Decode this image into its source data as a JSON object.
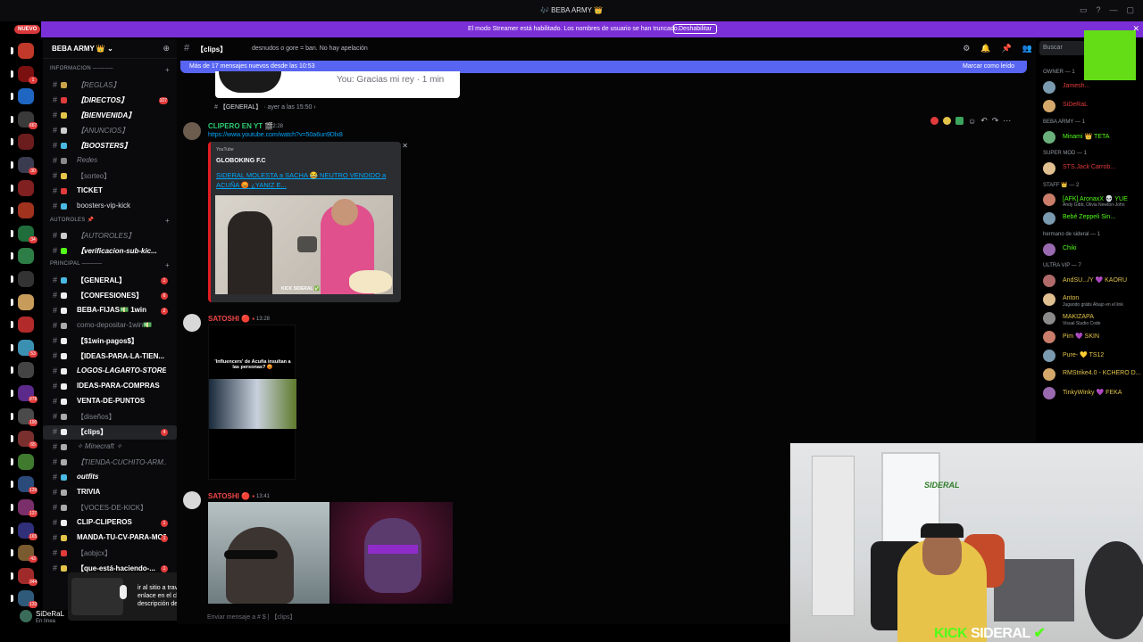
{
  "window": {
    "title": "🎶 BEBA ARMY 👑"
  },
  "nuevo_badge": "NUEVO",
  "servers": [
    {
      "color": "#c0392b",
      "badge": ""
    },
    {
      "color": "#7a1010",
      "badge": "1"
    },
    {
      "color": "#1e66c2",
      "badge": ""
    },
    {
      "color": "#3a3a3a",
      "badge": "667"
    },
    {
      "color": "#6b1d1d",
      "badge": ""
    },
    {
      "color": "#3b3b4f",
      "badge": "30"
    },
    {
      "color": "#802020",
      "badge": ""
    },
    {
      "color": "#a0321e",
      "badge": ""
    },
    {
      "color": "#1f6d3b",
      "badge": "34"
    },
    {
      "color": "#2d7d46",
      "badge": ""
    },
    {
      "color": "#333333",
      "badge": ""
    },
    {
      "color": "#c79c5a",
      "badge": ""
    },
    {
      "color": "#b22a2a",
      "badge": ""
    },
    {
      "color": "#3b8fb0",
      "badge": "53"
    },
    {
      "color": "#444444",
      "badge": ""
    },
    {
      "color": "#5c2a8a",
      "badge": "878"
    },
    {
      "color": "#4a4a4a",
      "badge": "190"
    },
    {
      "color": "#7a2f2f",
      "badge": "65"
    },
    {
      "color": "#3f7a2f",
      "badge": ""
    },
    {
      "color": "#2a4a7a",
      "badge": "139"
    },
    {
      "color": "#7a2f6a",
      "badge": "137"
    },
    {
      "color": "#2f2f7a",
      "badge": "165"
    },
    {
      "color": "#7a5a2f",
      "badge": "43"
    },
    {
      "color": "#a02a2a",
      "badge": "344"
    },
    {
      "color": "#2f5a7a",
      "badge": "133"
    }
  ],
  "streamer_bar": {
    "text": "El modo Streamer está habilitado. Los nombres de usuario se han truncado.",
    "button": "Deshabilitar",
    "close": "✕"
  },
  "server": {
    "name": "BEBA ARMY 👑 ⌄"
  },
  "categories": [
    {
      "label": "INFORMACION ─────"
    },
    {
      "label": "AUTOROLES 📌"
    },
    {
      "label": "PRINCIPAL ─────"
    }
  ],
  "channels": [
    {
      "name": "【REGLAS】",
      "emoji": "#c8a34a",
      "style": "m i",
      "badge": ""
    },
    {
      "name": "【DIRECTOS】",
      "emoji": "#e23b3b",
      "style": "b i",
      "badge": "107"
    },
    {
      "name": "【BIENVENIDA】",
      "emoji": "#e2c44a",
      "style": "b i",
      "badge": ""
    },
    {
      "name": "【ANUNCIOS】",
      "emoji": "#cccccc",
      "style": "m i",
      "badge": ""
    },
    {
      "name": "【BOOSTERS】",
      "emoji": "#4ab8e2",
      "style": "b i",
      "badge": ""
    },
    {
      "name": "Redes",
      "emoji": "#888888",
      "style": "m i",
      "badge": ""
    },
    {
      "name": "【sorteo】",
      "emoji": "#e2c44a",
      "style": "m",
      "badge": ""
    },
    {
      "name": "TICKET",
      "emoji": "#e23b3b",
      "style": "b",
      "badge": ""
    },
    {
      "name": "boosters-vip-kick",
      "emoji": "#4ab8e2",
      "style": "",
      "badge": ""
    },
    {
      "name": "【AUTOROLES】",
      "emoji": "#cccccc",
      "style": "m i",
      "badge": ""
    },
    {
      "name": "【verificacion-sub-kic...",
      "emoji": "#53fc18",
      "style": "b i",
      "badge": ""
    },
    {
      "name": "【GENERAL】",
      "emoji": "#4ab8e2",
      "style": "b",
      "badge": "1"
    },
    {
      "name": "【CONFESIONES】",
      "emoji": "#eeeeee",
      "style": "b",
      "badge": "6"
    },
    {
      "name": "BEBA-FIJAS💵 1win",
      "emoji": "#eeeeee",
      "style": "b",
      "badge": "2"
    },
    {
      "name": "como-depositar-1win💵",
      "emoji": "#aaaaaa",
      "style": "m",
      "badge": ""
    },
    {
      "name": "【$1win-pagos$】",
      "emoji": "#eeeeee",
      "style": "b",
      "badge": ""
    },
    {
      "name": "【IDEAS-PARA-LA-TIEN...",
      "emoji": "#eeeeee",
      "style": "b",
      "badge": ""
    },
    {
      "name": "LOGOS-LAGARTO-STORE",
      "emoji": "#eeeeee",
      "style": "b i",
      "badge": ""
    },
    {
      "name": "IDEAS-PARA-COMPRAS",
      "emoji": "#eeeeee",
      "style": "b",
      "badge": ""
    },
    {
      "name": "VENTA-DE-PUNTOS",
      "emoji": "#eeeeee",
      "style": "b",
      "badge": ""
    },
    {
      "name": "【diseños】",
      "emoji": "#aaaaaa",
      "style": "m",
      "badge": ""
    },
    {
      "name": "【clips】",
      "emoji": "#eeeeee",
      "style": "b",
      "badge": "4"
    },
    {
      "name": "✧ Minecraft ✧",
      "emoji": "#aaaaaa",
      "style": "m i",
      "badge": ""
    },
    {
      "name": "【TIENDA-CUCHITO-ARM...",
      "emoji": "#aaaaaa",
      "style": "m i",
      "badge": ""
    },
    {
      "name": "outfits",
      "emoji": "#4ab8e2",
      "style": "b i",
      "badge": ""
    },
    {
      "name": "TRIVIA",
      "emoji": "#aaaaaa",
      "style": "b",
      "badge": ""
    },
    {
      "name": "【VOCES-DE-KICK】",
      "emoji": "#aaaaaa",
      "style": "m",
      "badge": ""
    },
    {
      "name": "CLIP-CLIPEROS",
      "emoji": "#eeeeee",
      "style": "b",
      "badge": "1"
    },
    {
      "name": "MANDA-TU-CV-PARA-MOD",
      "emoji": "#e2c44a",
      "style": "b",
      "badge": "1"
    },
    {
      "name": "【aobjcx】",
      "emoji": "#e23b3b",
      "style": "m",
      "badge": ""
    },
    {
      "name": "【que-está-haciendo-...",
      "emoji": "#e2c44a",
      "style": "b",
      "badge": "1"
    }
  ],
  "user": {
    "name": "SiDeRaL",
    "status": "En línea"
  },
  "tooltip": {
    "text": "ir al sitio a través del enlace en el chat o la descripción del canal"
  },
  "header": {
    "channel": "【clips】",
    "topic": "desnudos o gore = ban. No hay apelación",
    "search_placeholder": "Buscar"
  },
  "new_messages": {
    "text": "Más de 17 mensajes nuevos desde las 10:53",
    "action": "Marcar como leído"
  },
  "top_message": {
    "text": "You: Gracias mi rey · 1 min"
  },
  "reply_line": {
    "channel": "【GENERAL】",
    "when": "· ayer a las 15:50 ›"
  },
  "messages": [
    {
      "author": "CLIPERO EN YT 🎬",
      "time": "12:28",
      "color": "#2ecc71",
      "link": "https://www.youtube.com/watch?v=50a6un9Dlx8",
      "embed": {
        "provider": "YouTube",
        "author": "GLOBOKING F.C",
        "title": "SIDERAL MOLESTA a SACHA 😂 NEUTRO VENDIDO a ACUÑA 😡 ¿YANIZ E...",
        "thumb_label": "KICK SIDERAL ✅"
      }
    },
    {
      "author": "SATOSHI 🔴 ▪",
      "time": "13:28",
      "color": "#f04747",
      "caption": "'Influencers' de Acuña insultan a las personas? 😡"
    },
    {
      "author": "SATOSHI 🔴 ▪",
      "time": "13:41",
      "color": "#f04747"
    }
  ],
  "input_placeholder": "Enviar mensaje a # $ | 【clips】",
  "members": [
    {
      "category": "OWNER — 1"
    },
    {
      "name": "Jamesh...",
      "status": "",
      "color": "#e23b3b"
    },
    {
      "name": "SiDeRaL",
      "status": "",
      "color": "#e23b3b"
    },
    {
      "category": "BEBA ARMY — 1"
    },
    {
      "name": "Minami 👑 TETA",
      "status": "",
      "color": "#53fc18"
    },
    {
      "category": "SUPER MOD — 1"
    },
    {
      "name": "STS.Jack Carrob...",
      "status": "",
      "color": "#e23b3b"
    },
    {
      "category": "STAFF 👑 — 2"
    },
    {
      "name": "[AFK] AronaxX 💀 YUE",
      "status": "Andy Gibb, Olivia Newton-John",
      "color": "#53fc18"
    },
    {
      "name": "Bebé Zeppeli Sin...",
      "status": "",
      "color": "#53fc18"
    },
    {
      "category": "hermano de sideral — 1"
    },
    {
      "name": "Chiki",
      "status": "",
      "color": "#53fc18"
    },
    {
      "category": "ULTRA VIP — 7"
    },
    {
      "name": "AndSU.../Y 💜 KAORU",
      "status": "",
      "color": "#e2c44a"
    },
    {
      "name": "Anton",
      "status": "Jugando grátis Abajo en el link",
      "color": "#e2c44a"
    },
    {
      "name": "MAKIZAPA",
      "status": "Visual Studio Code",
      "color": "#e2c44a"
    },
    {
      "name": "Pim 💜 SKIN",
      "status": "",
      "color": "#e2c44a"
    },
    {
      "name": "Pure- 💛 TS12",
      "status": "",
      "color": "#e2c44a"
    },
    {
      "name": "RMStrike4.0 - KCHERO D...",
      "status": "",
      "color": "#e2c44a"
    },
    {
      "name": "TinkyWinky 💜 FEKA",
      "status": "",
      "color": "#e2c44a"
    }
  ],
  "webcam": {
    "sign": "SIDERAL"
  },
  "overlay": {
    "brand": "KICK",
    "name": "SIDERAL"
  },
  "colors": {
    "accent": "#5865f2",
    "streamer": "#7b2fd6",
    "kick": "#53fc18",
    "unread": "#e23b3b"
  }
}
